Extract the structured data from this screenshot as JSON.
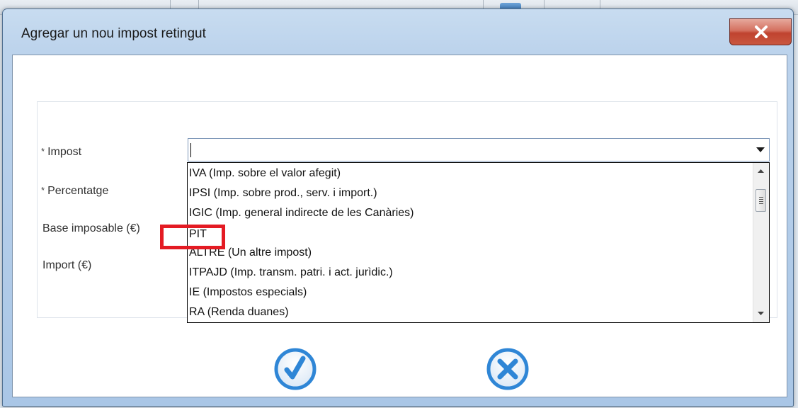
{
  "dialog": {
    "title": "Agregar un nou impost retingut"
  },
  "form": {
    "required_mark": "*",
    "labels": {
      "impost": "Impost",
      "percentatge": "Percentatge",
      "base_imposable": "Base imposable (€)",
      "import": "Import (€)"
    },
    "impost_value": ""
  },
  "dropdown": {
    "options": [
      "IVA (Imp. sobre el valor afegit)",
      "IPSI (Imp. sobre prod., serv. i import.)",
      "IGIC (Imp. general indirecte de les Canàries)",
      "PIT",
      "ALTRE (Un altre impost)",
      "ITPAJD (Imp. transm. patri. i act. jurìdic.)",
      "IE (Impostos especials)",
      "RA (Renda duanes)"
    ],
    "highlighted_option": "PIT"
  },
  "buttons": {
    "confirm_icon": "checkmark-circle-icon",
    "cancel_icon": "x-circle-icon",
    "close_icon": "close-x-icon"
  },
  "colors": {
    "button_blue": "#2f86d6",
    "close_red": "#c9503c",
    "highlight_red": "#e41b23"
  }
}
